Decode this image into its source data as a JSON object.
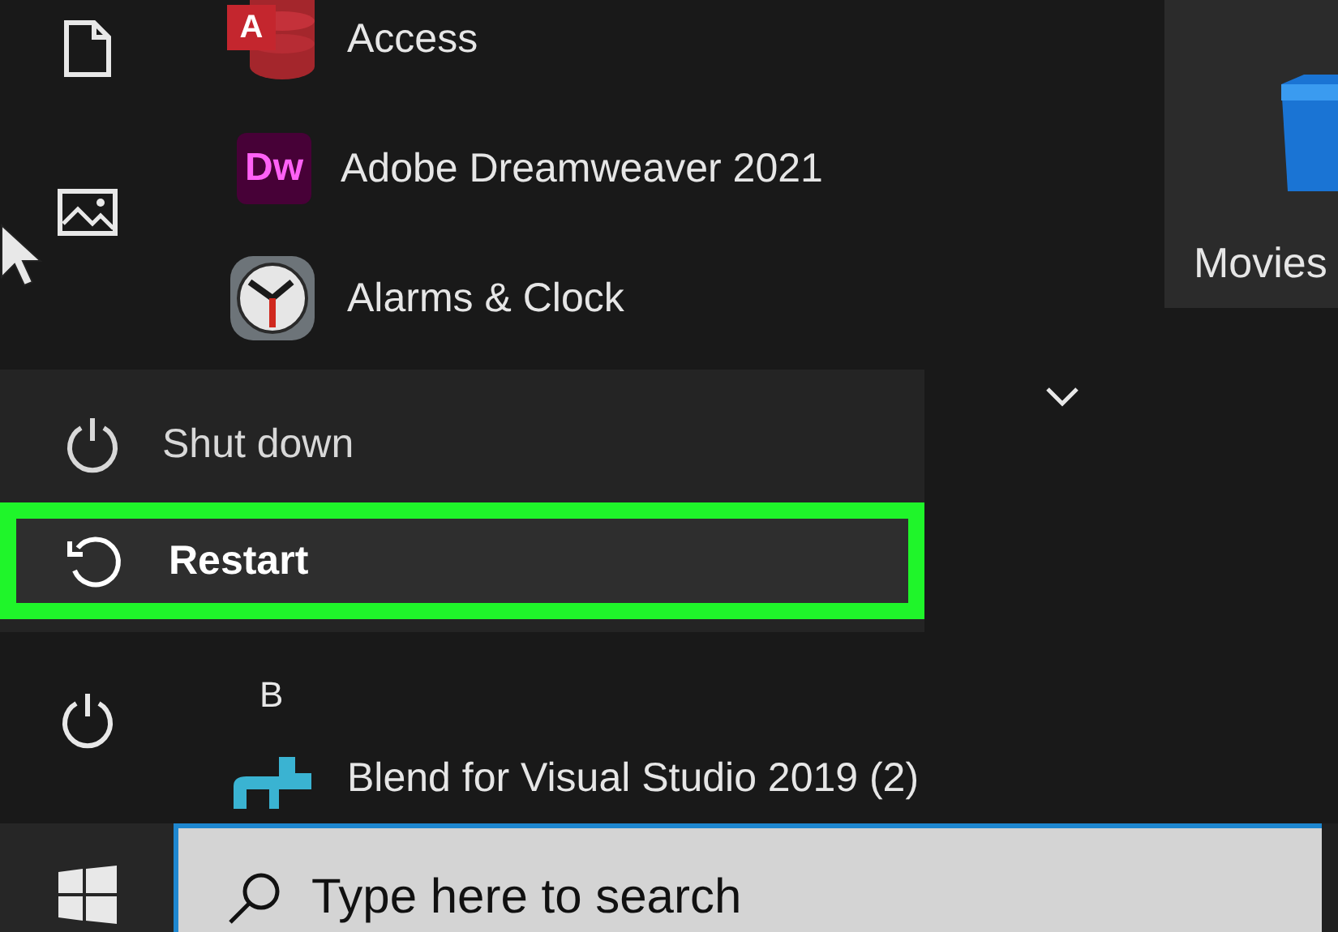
{
  "rail": [
    {
      "kind": "document"
    },
    {
      "kind": "pictures"
    },
    {
      "kind": "power"
    }
  ],
  "apps": [
    {
      "label": "Access",
      "kind": "access",
      "icon_text": "A"
    },
    {
      "label": "Adobe Dreamweaver 2021",
      "kind": "dreamweaver",
      "icon_text": "Dw"
    },
    {
      "label": "Alarms & Clock",
      "kind": "clock"
    }
  ],
  "group_header": "B",
  "apps_after": [
    {
      "label": "Blend for Visual Studio 2019 (2)",
      "kind": "blend"
    }
  ],
  "tile": {
    "label": "Movies"
  },
  "power_menu": {
    "items": [
      {
        "label": "Shut down",
        "kind": "shutdown",
        "selected": false
      },
      {
        "label": "Restart",
        "kind": "restart",
        "selected": true
      }
    ]
  },
  "search": {
    "placeholder": "Type here to search"
  }
}
